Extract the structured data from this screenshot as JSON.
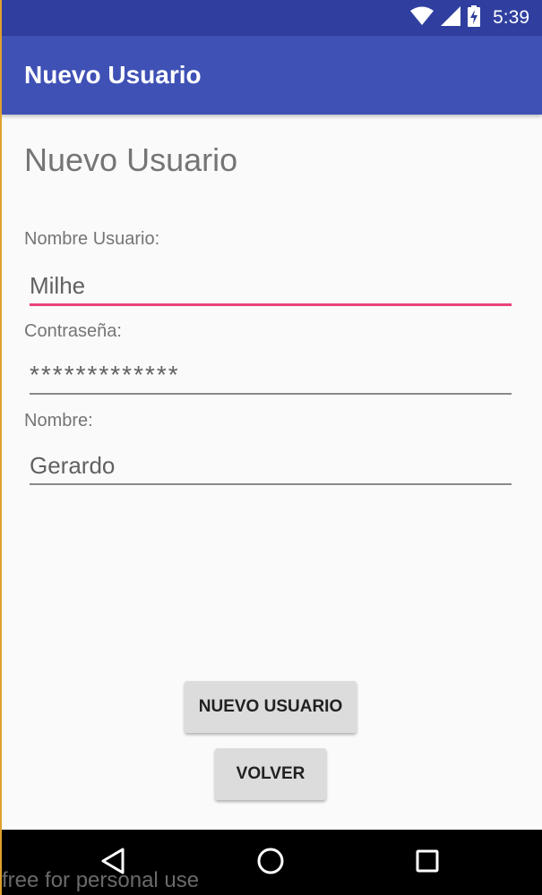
{
  "status_bar": {
    "time": "5:39",
    "icons": [
      "wifi-icon",
      "cell-signal-icon",
      "battery-charging-icon"
    ],
    "background": "#303f9f"
  },
  "app_bar": {
    "title": "Nuevo Usuario",
    "background": "#3f51b5"
  },
  "main": {
    "heading": "Nuevo Usuario",
    "fields": [
      {
        "label": "Nombre Usuario:",
        "value": "Milhe",
        "focused": true
      },
      {
        "label": "Contraseña:",
        "value": "*************",
        "type": "password"
      },
      {
        "label": "Nombre:",
        "value": "Gerardo"
      }
    ],
    "accent_color": "#ec407a"
  },
  "buttons": {
    "nuevo_usuario": "NUEVO USUARIO",
    "volver": "VOLVER"
  },
  "nav_bar": {
    "icons": [
      "back-icon",
      "home-icon",
      "recents-icon"
    ]
  },
  "watermark": "free for personal use"
}
